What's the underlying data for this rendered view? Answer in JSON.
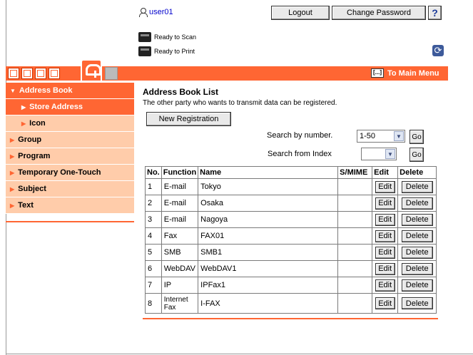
{
  "header": {
    "user_name": "user01",
    "logout_label": "Logout",
    "change_password_label": "Change Password",
    "help_label": "?",
    "scan_status": "Ready to Scan",
    "print_status": "Ready to Print"
  },
  "nav": {
    "to_main_menu_label": "To Main Menu",
    "to_main_menu_icon": "[...]"
  },
  "sidebar": {
    "items": [
      {
        "label": "Address Book"
      },
      {
        "label": "Store Address"
      },
      {
        "label": "Icon"
      },
      {
        "label": "Group"
      },
      {
        "label": "Program"
      },
      {
        "label": "Temporary One-Touch"
      },
      {
        "label": "Subject"
      },
      {
        "label": "Text"
      }
    ]
  },
  "main": {
    "title": "Address Book List",
    "description": "The other party who wants to transmit data can be registered.",
    "new_registration_label": "New Registration",
    "search_number_label": "Search by number.",
    "search_number_value": "1-50",
    "search_index_label": "Search from Index",
    "search_index_value": "",
    "go_label": "Go"
  },
  "table": {
    "headers": [
      "No.",
      "Function",
      "Name",
      "S/MIME",
      "Edit",
      "Delete"
    ],
    "edit_label": "Edit",
    "delete_label": "Delete",
    "rows": [
      {
        "no": "1",
        "function": "E-mail",
        "name": "Tokyo"
      },
      {
        "no": "2",
        "function": "E-mail",
        "name": "Osaka"
      },
      {
        "no": "3",
        "function": "E-mail",
        "name": "Nagoya"
      },
      {
        "no": "4",
        "function": "Fax",
        "name": "FAX01"
      },
      {
        "no": "5",
        "function": "SMB",
        "name": "SMB1"
      },
      {
        "no": "6",
        "function": "WebDAV",
        "name": "WebDAV1"
      },
      {
        "no": "7",
        "function": "IP",
        "name": "IPFax1"
      },
      {
        "no": "8",
        "function": "Internet Fax",
        "name": "I-FAX"
      }
    ]
  },
  "colors": {
    "accent": "#ff6633",
    "sidebar_light": "#ffccaa"
  }
}
